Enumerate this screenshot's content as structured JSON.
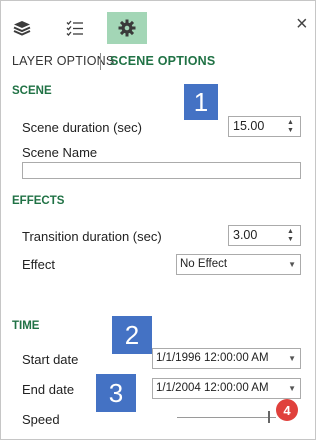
{
  "toolbar": {
    "buttons": [
      {
        "icon": "layers-icon",
        "active": false
      },
      {
        "icon": "checklist-icon",
        "active": false
      },
      {
        "icon": "gear-icon",
        "active": true
      }
    ],
    "close_label": "×"
  },
  "tabs": [
    {
      "label": "LAYER OPTIONS",
      "active": false
    },
    {
      "label": "SCENE OPTIONS",
      "active": true
    }
  ],
  "scene": {
    "heading": "SCENE",
    "duration_label": "Scene duration (sec)",
    "duration_value": "15.00",
    "name_label": "Scene Name",
    "name_value": ""
  },
  "effects": {
    "heading": "EFFECTS",
    "transition_label": "Transition duration (sec)",
    "transition_value": "3.00",
    "effect_label": "Effect",
    "effect_value": "No Effect"
  },
  "time": {
    "heading": "TIME",
    "start_label": "Start date",
    "start_value": "1/1/1996 12:00:00 AM",
    "end_label": "End date",
    "end_value": "1/1/2004 12:00:00 AM",
    "speed_label": "Speed",
    "speed_level": 0.92
  },
  "callouts": [
    "1",
    "2",
    "3",
    "4"
  ],
  "colors": {
    "accent_green": "#207245",
    "active_tab_bg": "#a3d6b6",
    "callout_blue": "#4472c4",
    "callout_red": "#e0403c"
  }
}
